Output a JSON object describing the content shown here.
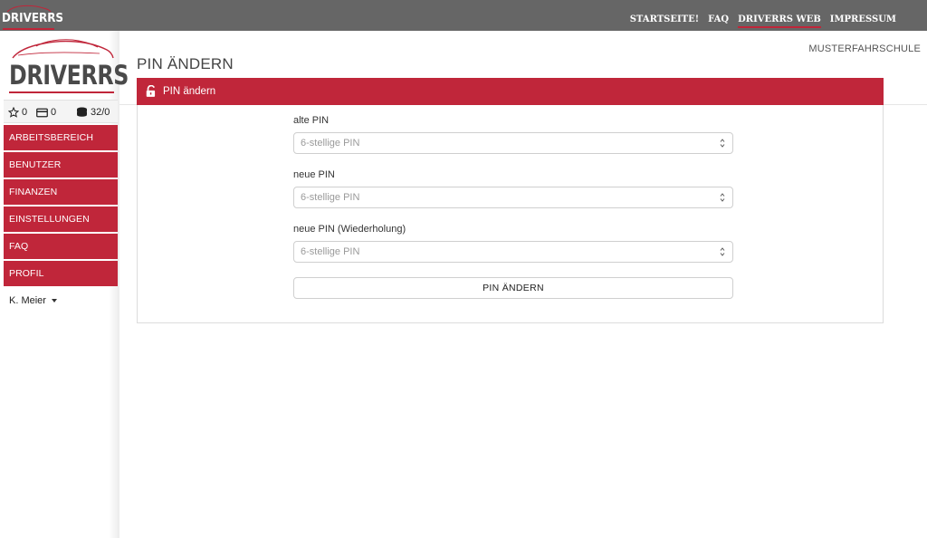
{
  "topbar": {
    "brand": "DRIVERRS",
    "nav": [
      "STARTSEITE!",
      "FAQ",
      "DRIVERRS WEB",
      "IMPRESSUM"
    ],
    "active_index": 2
  },
  "sidebar": {
    "logo_text": "DRIVERRS",
    "stats": {
      "stars": "0",
      "cards": "0",
      "coins": "32/0"
    },
    "menu": [
      "ARBEITSBEREICH",
      "BENUTZER",
      "FINANZEN",
      "EINSTELLUNGEN",
      "FAQ",
      "PROFIL"
    ],
    "user": "K. Meier"
  },
  "header": {
    "school": "MUSTERFAHRSCHULE",
    "page_title": "PIN ÄNDERN"
  },
  "panel": {
    "title": "PIN ändern",
    "fields": [
      {
        "label": "alte PIN",
        "placeholder": "6-stellige PIN"
      },
      {
        "label": "neue PIN",
        "placeholder": "6-stellige PIN"
      },
      {
        "label": "neue PIN (Wiederholung)",
        "placeholder": "6-stellige PIN"
      }
    ],
    "submit_label": "PIN ÄNDERN"
  },
  "colors": {
    "accent": "#c0263a",
    "topbar": "#666666"
  }
}
